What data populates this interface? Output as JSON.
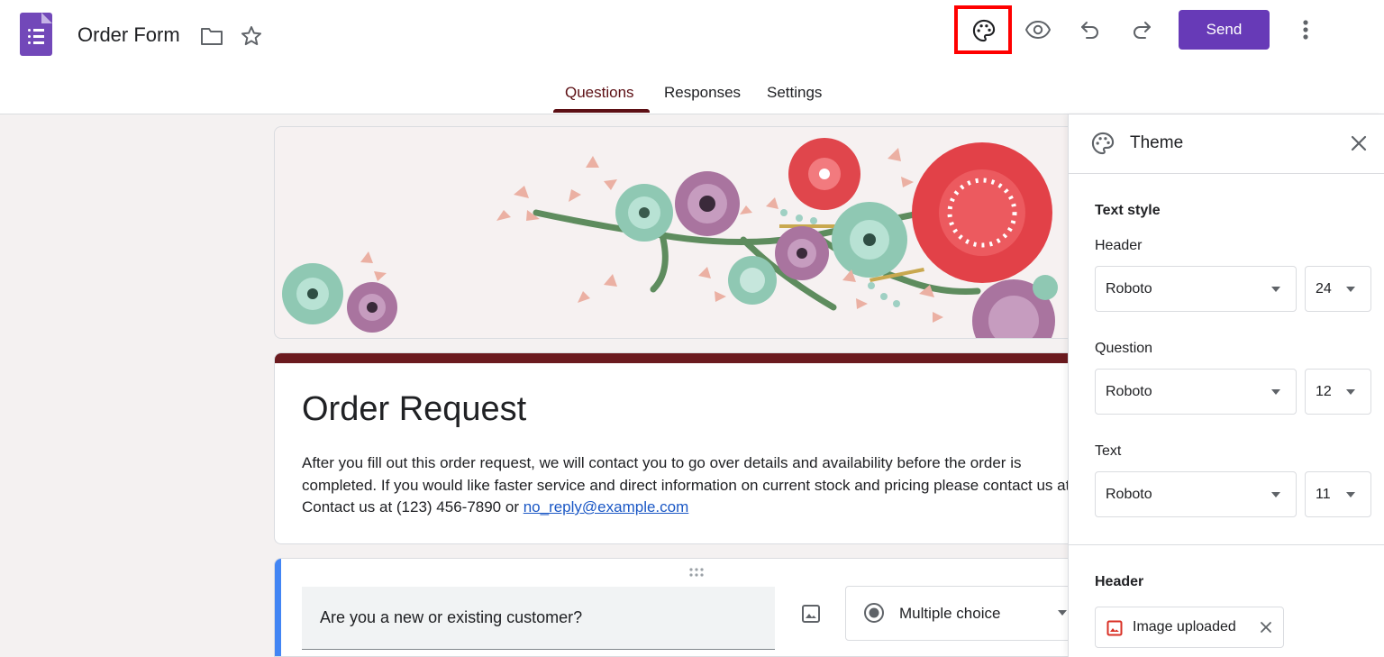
{
  "header": {
    "doc_title": "Order Form",
    "send_label": "Send",
    "icons": [
      "forms-logo-icon",
      "folder-icon",
      "star-icon",
      "palette-icon",
      "eye-icon",
      "undo-icon",
      "redo-icon",
      "more-vert-icon"
    ]
  },
  "tabs": [
    {
      "label": "Questions",
      "active": true
    },
    {
      "label": "Responses",
      "active": false
    },
    {
      "label": "Settings",
      "active": false
    }
  ],
  "form": {
    "title": "Order Request",
    "description_text": "After you fill out this order request, we will contact you to go over details and availability before the order is completed. If you would like faster service and direct information on current stock and pricing please contact us at Contact us at (123) 456-7890 or ",
    "email_link": "no_reply@example.com"
  },
  "question": {
    "text": "Are you a new or existing customer?",
    "type_label": "Multiple choice"
  },
  "theme_panel": {
    "title": "Theme",
    "text_style_heading": "Text style",
    "header_label": "Header",
    "header_font": "Roboto",
    "header_size": "24",
    "question_label": "Question",
    "question_font": "Roboto",
    "question_size": "12",
    "text_label": "Text",
    "text_font": "Roboto",
    "text_size": "11",
    "header_section_heading": "Header",
    "image_chip_label": "Image uploaded"
  },
  "colors": {
    "brand": "#673ab7",
    "theme_accent": "#6b1a1f",
    "highlight_box": "#ff0000",
    "background": "#f4f1f1"
  }
}
